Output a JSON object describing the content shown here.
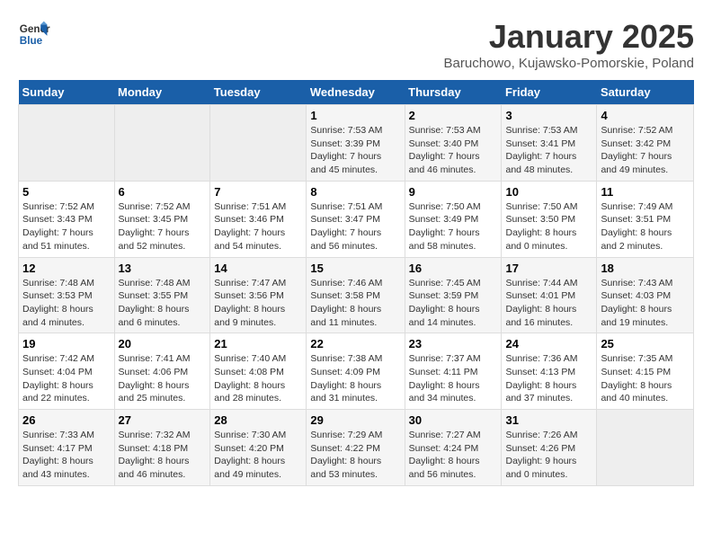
{
  "logo": {
    "line1": "General",
    "line2": "Blue"
  },
  "title": "January 2025",
  "subtitle": "Baruchowo, Kujawsko-Pomorskie, Poland",
  "weekdays": [
    "Sunday",
    "Monday",
    "Tuesday",
    "Wednesday",
    "Thursday",
    "Friday",
    "Saturday"
  ],
  "weeks": [
    [
      {
        "day": "",
        "info": ""
      },
      {
        "day": "",
        "info": ""
      },
      {
        "day": "",
        "info": ""
      },
      {
        "day": "1",
        "info": "Sunrise: 7:53 AM\nSunset: 3:39 PM\nDaylight: 7 hours\nand 45 minutes."
      },
      {
        "day": "2",
        "info": "Sunrise: 7:53 AM\nSunset: 3:40 PM\nDaylight: 7 hours\nand 46 minutes."
      },
      {
        "day": "3",
        "info": "Sunrise: 7:53 AM\nSunset: 3:41 PM\nDaylight: 7 hours\nand 48 minutes."
      },
      {
        "day": "4",
        "info": "Sunrise: 7:52 AM\nSunset: 3:42 PM\nDaylight: 7 hours\nand 49 minutes."
      }
    ],
    [
      {
        "day": "5",
        "info": "Sunrise: 7:52 AM\nSunset: 3:43 PM\nDaylight: 7 hours\nand 51 minutes."
      },
      {
        "day": "6",
        "info": "Sunrise: 7:52 AM\nSunset: 3:45 PM\nDaylight: 7 hours\nand 52 minutes."
      },
      {
        "day": "7",
        "info": "Sunrise: 7:51 AM\nSunset: 3:46 PM\nDaylight: 7 hours\nand 54 minutes."
      },
      {
        "day": "8",
        "info": "Sunrise: 7:51 AM\nSunset: 3:47 PM\nDaylight: 7 hours\nand 56 minutes."
      },
      {
        "day": "9",
        "info": "Sunrise: 7:50 AM\nSunset: 3:49 PM\nDaylight: 7 hours\nand 58 minutes."
      },
      {
        "day": "10",
        "info": "Sunrise: 7:50 AM\nSunset: 3:50 PM\nDaylight: 8 hours\nand 0 minutes."
      },
      {
        "day": "11",
        "info": "Sunrise: 7:49 AM\nSunset: 3:51 PM\nDaylight: 8 hours\nand 2 minutes."
      }
    ],
    [
      {
        "day": "12",
        "info": "Sunrise: 7:48 AM\nSunset: 3:53 PM\nDaylight: 8 hours\nand 4 minutes."
      },
      {
        "day": "13",
        "info": "Sunrise: 7:48 AM\nSunset: 3:55 PM\nDaylight: 8 hours\nand 6 minutes."
      },
      {
        "day": "14",
        "info": "Sunrise: 7:47 AM\nSunset: 3:56 PM\nDaylight: 8 hours\nand 9 minutes."
      },
      {
        "day": "15",
        "info": "Sunrise: 7:46 AM\nSunset: 3:58 PM\nDaylight: 8 hours\nand 11 minutes."
      },
      {
        "day": "16",
        "info": "Sunrise: 7:45 AM\nSunset: 3:59 PM\nDaylight: 8 hours\nand 14 minutes."
      },
      {
        "day": "17",
        "info": "Sunrise: 7:44 AM\nSunset: 4:01 PM\nDaylight: 8 hours\nand 16 minutes."
      },
      {
        "day": "18",
        "info": "Sunrise: 7:43 AM\nSunset: 4:03 PM\nDaylight: 8 hours\nand 19 minutes."
      }
    ],
    [
      {
        "day": "19",
        "info": "Sunrise: 7:42 AM\nSunset: 4:04 PM\nDaylight: 8 hours\nand 22 minutes."
      },
      {
        "day": "20",
        "info": "Sunrise: 7:41 AM\nSunset: 4:06 PM\nDaylight: 8 hours\nand 25 minutes."
      },
      {
        "day": "21",
        "info": "Sunrise: 7:40 AM\nSunset: 4:08 PM\nDaylight: 8 hours\nand 28 minutes."
      },
      {
        "day": "22",
        "info": "Sunrise: 7:38 AM\nSunset: 4:09 PM\nDaylight: 8 hours\nand 31 minutes."
      },
      {
        "day": "23",
        "info": "Sunrise: 7:37 AM\nSunset: 4:11 PM\nDaylight: 8 hours\nand 34 minutes."
      },
      {
        "day": "24",
        "info": "Sunrise: 7:36 AM\nSunset: 4:13 PM\nDaylight: 8 hours\nand 37 minutes."
      },
      {
        "day": "25",
        "info": "Sunrise: 7:35 AM\nSunset: 4:15 PM\nDaylight: 8 hours\nand 40 minutes."
      }
    ],
    [
      {
        "day": "26",
        "info": "Sunrise: 7:33 AM\nSunset: 4:17 PM\nDaylight: 8 hours\nand 43 minutes."
      },
      {
        "day": "27",
        "info": "Sunrise: 7:32 AM\nSunset: 4:18 PM\nDaylight: 8 hours\nand 46 minutes."
      },
      {
        "day": "28",
        "info": "Sunrise: 7:30 AM\nSunset: 4:20 PM\nDaylight: 8 hours\nand 49 minutes."
      },
      {
        "day": "29",
        "info": "Sunrise: 7:29 AM\nSunset: 4:22 PM\nDaylight: 8 hours\nand 53 minutes."
      },
      {
        "day": "30",
        "info": "Sunrise: 7:27 AM\nSunset: 4:24 PM\nDaylight: 8 hours\nand 56 minutes."
      },
      {
        "day": "31",
        "info": "Sunrise: 7:26 AM\nSunset: 4:26 PM\nDaylight: 9 hours\nand 0 minutes."
      },
      {
        "day": "",
        "info": ""
      }
    ]
  ]
}
